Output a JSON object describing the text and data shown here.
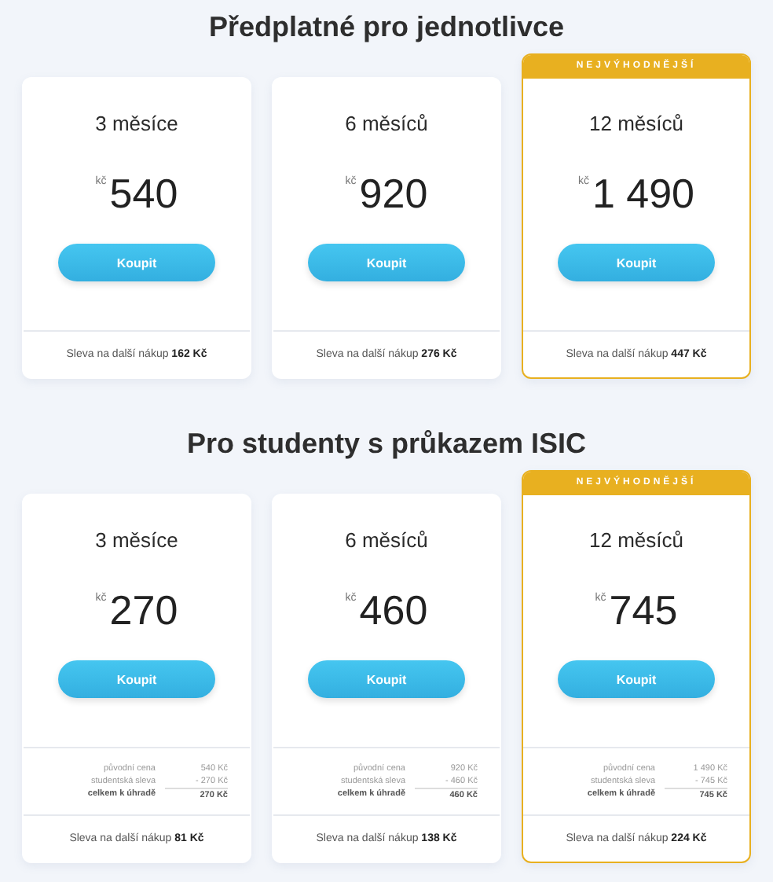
{
  "sections": [
    {
      "title": "Předplatné pro jednotlivce",
      "plans": [
        {
          "period": "3 měsíce",
          "currency": "kč",
          "price": "540",
          "button": "Koupit",
          "featured": false,
          "footer": "Sleva na další nákup **162 Kč**"
        },
        {
          "period": "6 měsíců",
          "currency": "kč",
          "price": "920",
          "button": "Koupit",
          "featured": false,
          "footer": "Sleva na další nákup **276 Kč**"
        },
        {
          "badge": "NEJVÝHODNĚJŠÍ",
          "period": "12 měsíců",
          "currency": "kč",
          "price": "1 490",
          "button": "Koupit",
          "featured": true,
          "footer": "Sleva na další nákup **447 Kč**"
        }
      ]
    },
    {
      "title": "Pro studenty s průkazem ISIC",
      "plans": [
        {
          "period": "3 měsíce",
          "currency": "kč",
          "price": "270",
          "button": "Koupit",
          "featured": false,
          "breakdown": [
            {
              "kind": "line",
              "label": "původní cena",
              "value": "540 Kč"
            },
            {
              "kind": "line",
              "label": "studentská sleva",
              "value": "- 270 Kč"
            },
            {
              "kind": "total",
              "label": "celkem k úhradě",
              "value": "270 Kč"
            }
          ],
          "footer": "Sleva na další nákup **81 Kč**"
        },
        {
          "period": "6 měsíců",
          "currency": "kč",
          "price": "460",
          "button": "Koupit",
          "featured": false,
          "breakdown": [
            {
              "kind": "line",
              "label": "původní cena",
              "value": "920 Kč"
            },
            {
              "kind": "line",
              "label": "studentská sleva",
              "value": "- 460 Kč"
            },
            {
              "kind": "total",
              "label": "celkem k úhradě",
              "value": "460 Kč"
            }
          ],
          "footer": "Sleva na další nákup **138 Kč**"
        },
        {
          "badge": "NEJVÝHODNĚJŠÍ",
          "period": "12 měsíců",
          "currency": "kč",
          "price": "745",
          "button": "Koupit",
          "featured": true,
          "breakdown": [
            {
              "kind": "line",
              "label": "původní cena",
              "value": "1 490 Kč"
            },
            {
              "kind": "line",
              "label": "studentská sleva",
              "value": "- 745 Kč"
            },
            {
              "kind": "total",
              "label": "celkem k úhradě",
              "value": "745 Kč"
            }
          ],
          "footer": "Sleva na další nákup **224 Kč**"
        }
      ]
    }
  ]
}
